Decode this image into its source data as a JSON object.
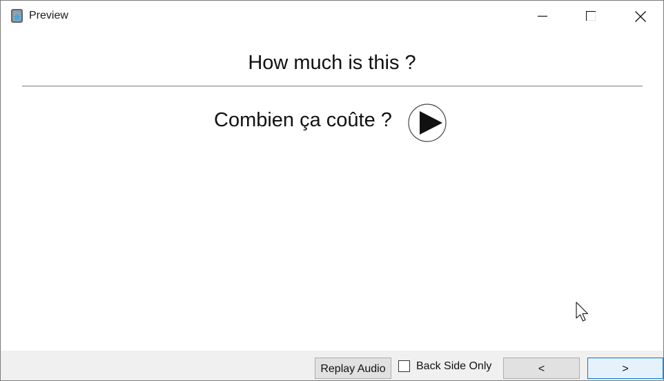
{
  "window": {
    "title": "Preview",
    "icon": "app-icon",
    "controls": [
      "minimize-icon",
      "maximize-icon",
      "close-icon"
    ]
  },
  "card": {
    "front_text": "How much is this ?",
    "back_text": "Combien ça coûte ?",
    "audio_icon": "play-icon"
  },
  "toolbar": {
    "replay_label": "Replay Audio",
    "back_only_label": "Back Side Only",
    "back_only_checked": false,
    "prev_label": "<",
    "next_label": ">"
  },
  "colors": {
    "bottom_bar": "#f0f0f0",
    "button_bg": "#e1e1e1",
    "focused_button_border": "#0078d7"
  }
}
